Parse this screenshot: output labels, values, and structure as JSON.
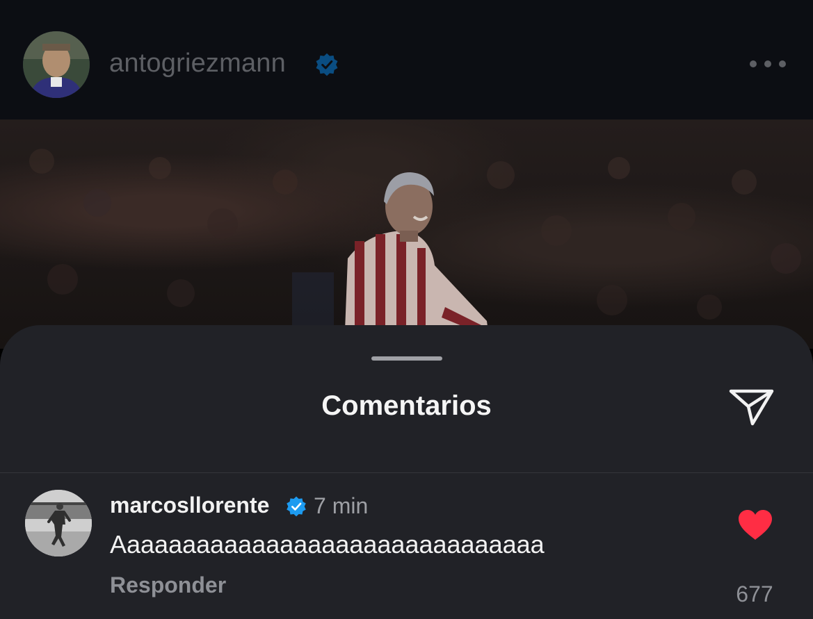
{
  "post": {
    "username": "antogriezmann",
    "verified": true,
    "more_icon": "more-horizontal-icon"
  },
  "comments_sheet": {
    "title": "Comentarios",
    "share_icon": "send-icon",
    "comments": [
      {
        "username": "marcosllorente",
        "verified": true,
        "time": "7 min",
        "text": "Aaaaaaaaaaaaaaaaaaaaaaaaaaaaaaa",
        "reply_label": "Responder",
        "liked": true,
        "like_count": "677"
      }
    ]
  },
  "colors": {
    "verified_badge": "#1d9bf0",
    "like_red": "#ff2d44",
    "sheet_bg": "#212227"
  }
}
